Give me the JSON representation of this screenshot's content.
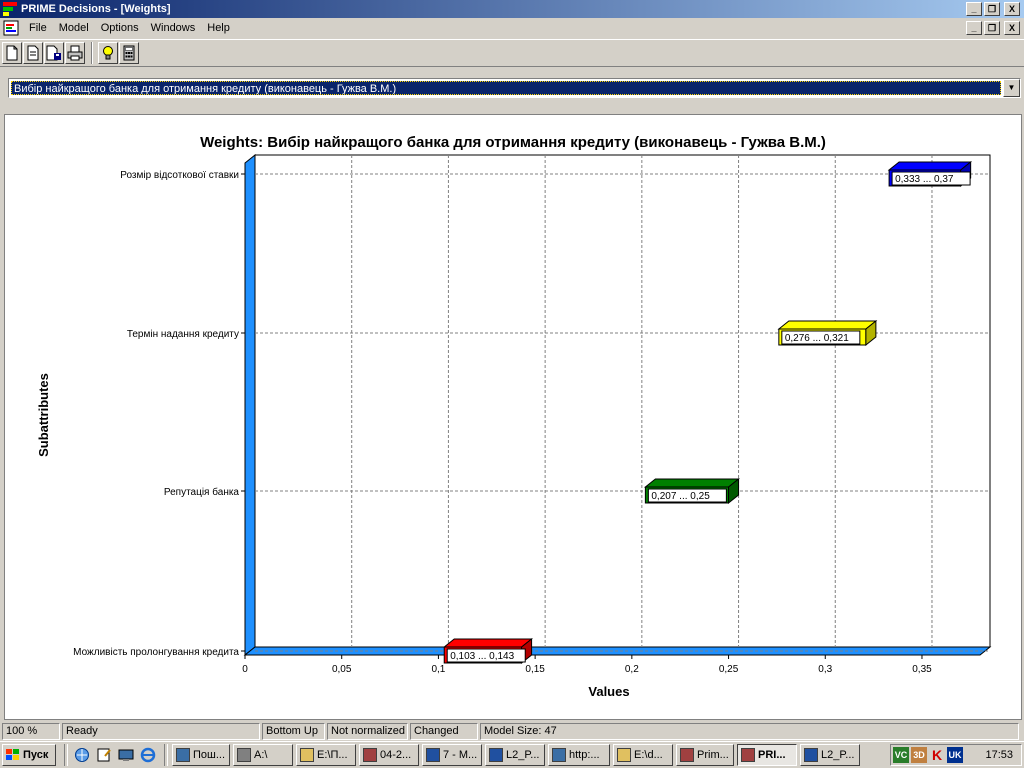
{
  "window": {
    "title": "PRIME Decisions - [Weights]",
    "title_controls": [
      "_",
      "❐",
      "X"
    ],
    "doc_controls": [
      "_",
      "❐",
      "X"
    ]
  },
  "menu": {
    "items": [
      "File",
      "Model",
      "Options",
      "Windows",
      "Help"
    ]
  },
  "toolbar": {
    "buttons": [
      "new-document-icon",
      "open-document-icon",
      "save-document-icon",
      "print-icon",
      "lightbulb-icon",
      "calculator-icon"
    ]
  },
  "selector": {
    "value": "Вибір найкращого банка для отримання кредиту (виконавець - Гужва В.М.)",
    "arrow": "▼"
  },
  "chart_data": {
    "type": "bar",
    "orientation": "horizontal-interval",
    "title": "Weights: Вибір найкращого банка для отримання кредиту (виконавець - Гужва В.М.)",
    "xlabel": "Values",
    "ylabel": "Subattributes",
    "xlim": [
      0,
      0.38
    ],
    "xticks": [
      "0",
      "0,05",
      "0,1",
      "0,15",
      "0,2",
      "0,25",
      "0,3",
      "0,35"
    ],
    "xtick_values": [
      0,
      0.05,
      0.1,
      0.15,
      0.2,
      0.25,
      0.3,
      0.35
    ],
    "grid": true,
    "categories": [
      "Розмір відсоткової ставки",
      "Термін надання кредиту",
      "Репутація банка",
      "Можливість пролонгування кредита"
    ],
    "intervals": [
      {
        "low": 0.333,
        "high": 0.37,
        "label": "0,333 ... 0,37",
        "color": "#0000ff"
      },
      {
        "low": 0.276,
        "high": 0.321,
        "label": "0,276 ... 0,321",
        "color": "#ffff00"
      },
      {
        "low": 0.207,
        "high": 0.25,
        "label": "0,207 ... 0,25",
        "color": "#008000"
      },
      {
        "low": 0.103,
        "high": 0.143,
        "label": "0,103 ... 0,143",
        "color": "#ff0000"
      }
    ],
    "wall_color": "#1e90ff"
  },
  "status": {
    "zoom": "100 %",
    "state": "Ready",
    "order": "Bottom Up",
    "normalization": "Not normalized",
    "modified": "Changed",
    "model_size": "Model Size: 47"
  },
  "taskbar": {
    "start_label": "Пуск",
    "tasks": [
      {
        "label": "Пош...",
        "active": false
      },
      {
        "label": "A:\\",
        "active": false
      },
      {
        "label": "E:\\П...",
        "active": false
      },
      {
        "label": "04-2...",
        "active": false
      },
      {
        "label": "7 - M...",
        "active": false
      },
      {
        "label": "L2_P...",
        "active": false
      },
      {
        "label": "http:...",
        "active": false
      },
      {
        "label": "E:\\d...",
        "active": false
      },
      {
        "label": "Prim...",
        "active": false
      },
      {
        "label": "PRI...",
        "active": true
      },
      {
        "label": "L2_P...",
        "active": false
      }
    ],
    "tray_lang": "UK",
    "clock": "17:53"
  }
}
